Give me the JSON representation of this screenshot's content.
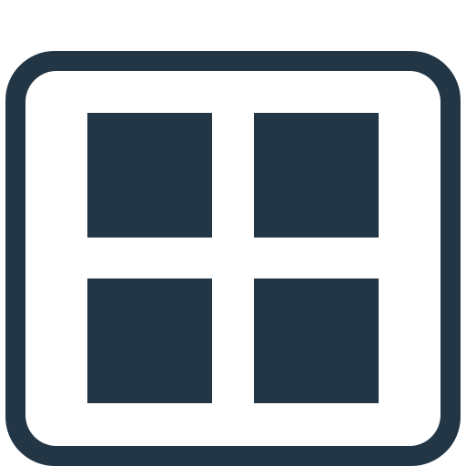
{
  "icon": {
    "semantic": "grid-view-icon",
    "color": "#223646",
    "background": "#ffffff",
    "tile_count": 4
  }
}
